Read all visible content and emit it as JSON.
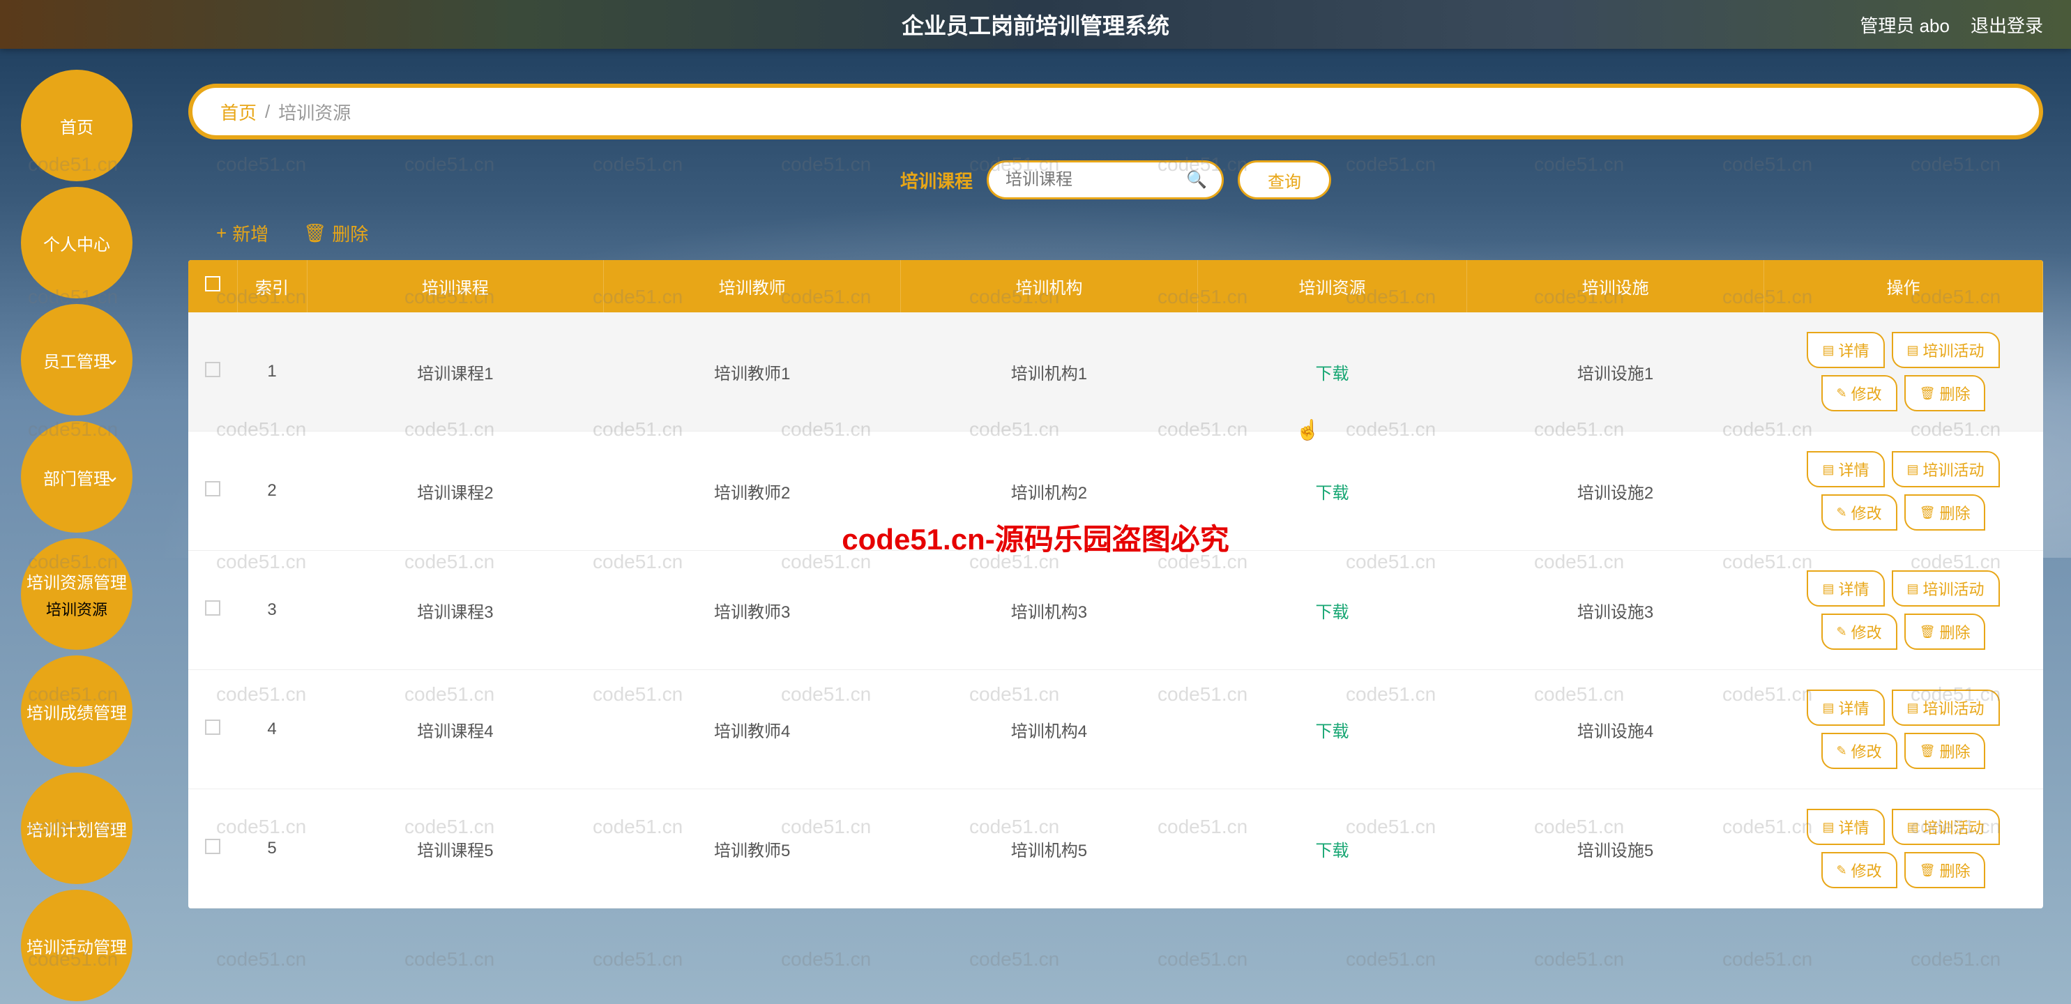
{
  "header": {
    "title": "企业员工岗前培训管理系统",
    "admin_label": "管理员 abo",
    "logout_label": "退出登录"
  },
  "sidebar": {
    "items": [
      {
        "label": "首页",
        "sub": null,
        "has_sub": false
      },
      {
        "label": "个人中心",
        "sub": null,
        "has_sub": false
      },
      {
        "label": "员工管理",
        "sub": null,
        "has_sub": true
      },
      {
        "label": "部门管理",
        "sub": null,
        "has_sub": true
      },
      {
        "label": "培训资源管理",
        "sub": "培训资源",
        "has_sub": false
      },
      {
        "label": "培训成绩管理",
        "sub": null,
        "has_sub": false
      },
      {
        "label": "培训计划管理",
        "sub": null,
        "has_sub": false
      },
      {
        "label": "培训活动管理",
        "sub": null,
        "has_sub": false
      }
    ]
  },
  "breadcrumb": {
    "home": "首页",
    "sep": "/",
    "current": "培训资源"
  },
  "search": {
    "label": "培训课程",
    "placeholder": "培训课程",
    "button": "查询"
  },
  "toolbar": {
    "add_label": "新增",
    "delete_label": "删除"
  },
  "table": {
    "headers": {
      "check": "",
      "index": "索引",
      "course": "培训课程",
      "teacher": "培训教师",
      "org": "培训机构",
      "resource": "培训资源",
      "facility": "培训设施",
      "ops": "操作"
    },
    "download_label": "下载",
    "ops": {
      "detail": "详情",
      "activity": "培训活动",
      "edit": "修改",
      "delete": "删除"
    },
    "rows": [
      {
        "index": "1",
        "course": "培训课程1",
        "teacher": "培训教师1",
        "org": "培训机构1",
        "resource": "下载",
        "facility": "培训设施1"
      },
      {
        "index": "2",
        "course": "培训课程2",
        "teacher": "培训教师2",
        "org": "培训机构2",
        "resource": "下载",
        "facility": "培训设施2"
      },
      {
        "index": "3",
        "course": "培训课程3",
        "teacher": "培训教师3",
        "org": "培训机构3",
        "resource": "下载",
        "facility": "培训设施3"
      },
      {
        "index": "4",
        "course": "培训课程4",
        "teacher": "培训教师4",
        "org": "培训机构4",
        "resource": "下载",
        "facility": "培训设施4"
      },
      {
        "index": "5",
        "course": "培训课程5",
        "teacher": "培训教师5",
        "org": "培训机构5",
        "resource": "下载",
        "facility": "培训设施5"
      }
    ]
  },
  "watermark": {
    "text": "code51.cn",
    "red": "code51.cn-源码乐园盗图必究"
  }
}
